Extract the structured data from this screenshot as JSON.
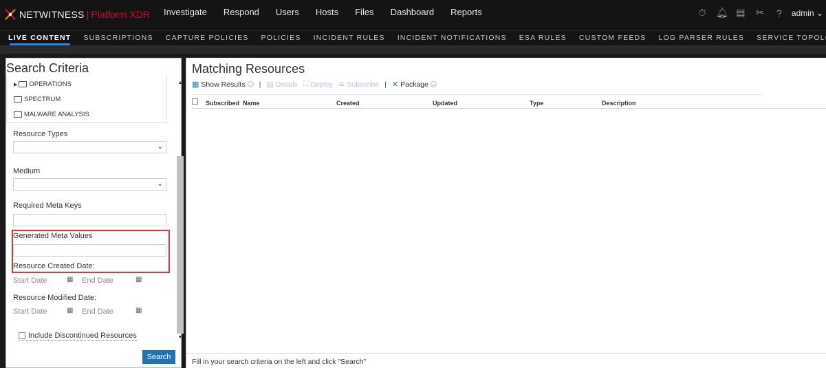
{
  "brand": {
    "name": "NETWITNESS",
    "separator": "|",
    "product": "Platform XDR",
    "accent": "#c8102e"
  },
  "main_nav": [
    "Investigate",
    "Respond",
    "Users",
    "Hosts",
    "Files",
    "Dashboard",
    "Reports"
  ],
  "top_icons": [
    "timer-icon",
    "bell-icon",
    "notes-icon",
    "tools-icon",
    "help-icon"
  ],
  "user": {
    "name": "admin"
  },
  "sub_nav": {
    "items": [
      "LIVE CONTENT",
      "SUBSCRIPTIONS",
      "CAPTURE POLICIES",
      "POLICIES",
      "INCIDENT RULES",
      "INCIDENT NOTIFICATIONS",
      "ESA RULES",
      "CUSTOM FEEDS",
      "LOG PARSER RULES",
      "SERVICE TOPOLOGY"
    ],
    "active": "LIVE CONTENT",
    "active_color": "#1e88e5"
  },
  "search_panel": {
    "title": "Search Criteria",
    "tree": [
      "OPERATIONS",
      "SPECTRUM",
      "MALWARE ANALYSIS"
    ],
    "resource_types_label": "Resource Types",
    "medium_label": "Medium",
    "required_meta_keys_label": "Required Meta Keys",
    "generated_meta_values_label": "Generated Meta Values",
    "resource_created_label": "Resource Created Date:",
    "resource_modified_label": "Resource Modified Date:",
    "start_date_placeholder": "Start Date",
    "end_date_placeholder": "End Date",
    "include_discontinued_label": "Include Discontinued Resources",
    "search_button": "Search",
    "highlight_color": "#d9363e"
  },
  "results_panel": {
    "title": "Matching Resources",
    "toolbar": {
      "show_results": "Show Results",
      "details": "Details",
      "deploy": "Deploy",
      "subscribe": "Subscribe",
      "package": "Package"
    },
    "columns": [
      "Subscribed",
      "Name",
      "Created",
      "Updated",
      "Type",
      "Description"
    ],
    "status_text": "Fill in your search criteria on the left and click \"Search\""
  }
}
